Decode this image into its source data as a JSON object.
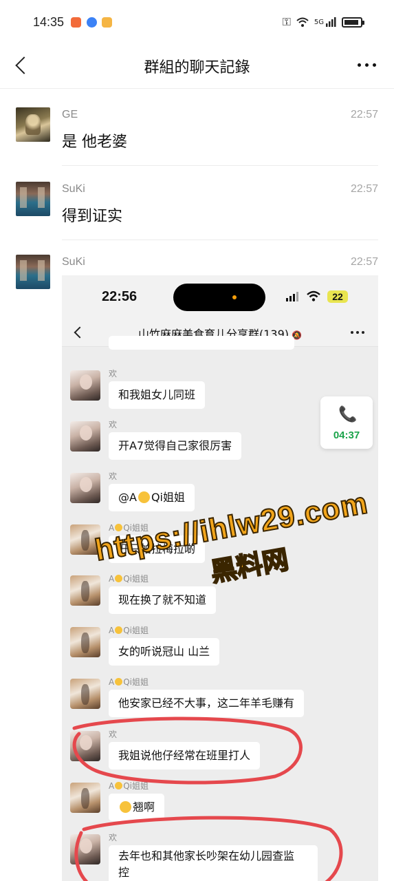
{
  "status_bar": {
    "time": "14:35",
    "network": "5G",
    "app_icon_colors": [
      "#f26b3a",
      "#3b82f6",
      "#f5b544"
    ]
  },
  "nav": {
    "title": "群組的聊天記錄",
    "back_icon": "chevron-left-icon",
    "more_icon": "more-dots-icon"
  },
  "messages": [
    {
      "sender": "GE",
      "time": "22:57",
      "text": "是 他老婆"
    },
    {
      "sender": "SuKi",
      "time": "22:57",
      "text": "得到证实"
    },
    {
      "sender": "SuKi",
      "time": "22:57",
      "text": ""
    }
  ],
  "screenshot": {
    "status_time": "22:56",
    "battery": "22",
    "group_title": "山竹麻麻美食育儿分享群(139)",
    "call_duration": "04:37",
    "chat": [
      {
        "name": "欢",
        "text": "和我姐女儿同班"
      },
      {
        "name": "欢",
        "text": "开A7觉得自己家很厉害"
      },
      {
        "name": "欢",
        "text_a": "@A",
        "text_b": "Qi姐姐"
      },
      {
        "name_a": "A",
        "name_b": "Qi姐姐",
        "text": "开只帕拉梅拉啲"
      },
      {
        "name_a": "A",
        "name_b": "Qi姐姐",
        "text": "现在换了就不知道"
      },
      {
        "name_a": "A",
        "name_b": "Qi姐姐",
        "text": "女的听说冠山 山兰"
      },
      {
        "name_a": "A",
        "name_b": "Qi姐姐",
        "text": "他安家已经不大事，这二年羊毛赚有"
      },
      {
        "name": "欢",
        "text": "我姐说他仔经常在班里打人"
      },
      {
        "name_a": "A",
        "name_b": "Qi姐姐",
        "text": "翘啊"
      },
      {
        "name": "欢",
        "text_line1": "去年也和其他家长吵架在幼儿园查监",
        "text_line2": "控"
      }
    ]
  },
  "watermark": {
    "url": "https://ihlw29.com",
    "label": "黑料网",
    "color": "#f2a51b"
  },
  "annotation_color": "#e5484d"
}
